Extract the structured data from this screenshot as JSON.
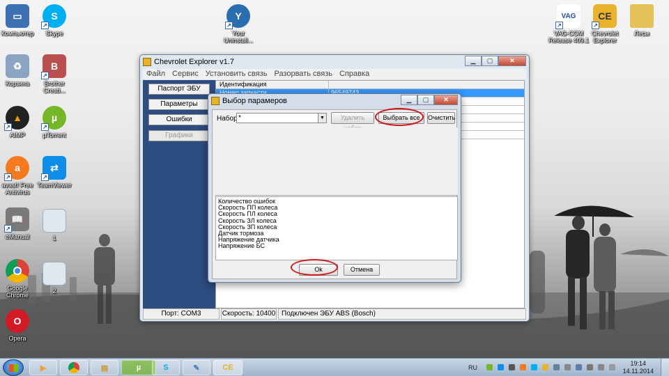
{
  "desktop": {
    "icons": [
      {
        "label": "Компьютер",
        "icon": "computer-icon",
        "color": "#3d6fb3"
      },
      {
        "label": "Skype",
        "icon": "skype-icon",
        "color": "#00aff0"
      },
      {
        "label": "Your Uninstall...",
        "icon": "uninstaller-icon",
        "color": "#2b6db1"
      },
      {
        "label": "VAG-COM Release 409.1",
        "icon": "vag-com-icon",
        "color": "#1e4f9e"
      },
      {
        "label": "Chevrolet Explorer",
        "icon": "chevrolet-explorer-icon",
        "color": "#e8b22b"
      },
      {
        "label": "Лесы",
        "icon": "folder-icon",
        "color": "#e3c35a"
      },
      {
        "label": "Корзина",
        "icon": "recycle-bin-icon",
        "color": "#8aa4c2"
      },
      {
        "label": "Brother Creati...",
        "icon": "brother-icon",
        "color": "#b94f4f"
      },
      {
        "label": "AIMP",
        "icon": "aimp-icon",
        "color": "#f29b0c"
      },
      {
        "label": "µTorrent",
        "icon": "utorrent-icon",
        "color": "#76b729"
      },
      {
        "label": "avast! Free Antivirus",
        "icon": "avast-icon",
        "color": "#f47a1f"
      },
      {
        "label": "TeamViewer",
        "icon": "teamviewer-icon",
        "color": "#0e8ee9"
      },
      {
        "label": "eManual",
        "icon": "emanual-icon",
        "color": "#7a7a7a"
      },
      {
        "label": "1",
        "icon": "image-file-icon",
        "color": "#9ab0c8"
      },
      {
        "label": "Google Chrome",
        "icon": "chrome-icon",
        "color": "#db4437"
      },
      {
        "label": "2",
        "icon": "image-file-icon",
        "color": "#9ab0c8"
      },
      {
        "label": "Opera",
        "icon": "opera-icon",
        "color": "#d21a26"
      }
    ]
  },
  "app": {
    "title": "Chevrolet Explorer v1.7",
    "menu": [
      "Файл",
      "Сервис",
      "Установить связь",
      "Разорвать связь",
      "Справка"
    ],
    "left_buttons": [
      "Паспорт ЭБУ",
      "Параметры",
      "Ошибки",
      "Графики"
    ],
    "grid": {
      "header": [
        "Идентификация",
        ""
      ],
      "rows": [
        [
          "Номер запчасти",
          "96549743"
        ],
        [
          "",
          ""
        ],
        [
          "",
          ""
        ],
        [
          "",
          ""
        ],
        [
          "",
          ""
        ],
        [
          "",
          ""
        ]
      ]
    },
    "status": {
      "port": "Порт: COM3",
      "speed": "Скорость: 10400",
      "connection": "Подключен ЭБУ ABS (Bosch)"
    }
  },
  "dialog": {
    "title": "Выбор парамеров",
    "set_label": "Набор",
    "set_value": "*",
    "delete_set_label": "Удалить набор",
    "select_all_label": "Выбрать все",
    "clear_label": "Очистить",
    "parameters": [
      "Количество ошибок",
      "Скорость ПП колеса",
      "Скорость ПЛ колеса",
      "Скорость ЗЛ колеса",
      "Скорость ЗП колеса",
      "Датчик тормоза",
      "Напряжение датчика",
      "Напряжение БС"
    ],
    "ok_label": "Ok",
    "cancel_label": "Отмена"
  },
  "taskbar": {
    "items": [
      {
        "icon": "windows-media-player-icon",
        "color": "#f0a22e"
      },
      {
        "icon": "chrome-icon",
        "color": "#db4437"
      },
      {
        "icon": "file-explorer-icon",
        "color": "#e3c35a"
      },
      {
        "icon": "utorrent-icon",
        "color": "#76b729"
      },
      {
        "icon": "skype-icon",
        "color": "#00aff0"
      },
      {
        "icon": "paint-icon",
        "color": "#8fb6e0"
      },
      {
        "icon": "chevrolet-explorer-icon",
        "color": "#e8b22b"
      }
    ],
    "language": "RU",
    "time": "19:14",
    "date": "14.11.2014"
  },
  "colors": {
    "annotation_red": "#d4131b",
    "selection_blue": "#3399ff",
    "left_pane_blue": "#2d4c7f"
  }
}
